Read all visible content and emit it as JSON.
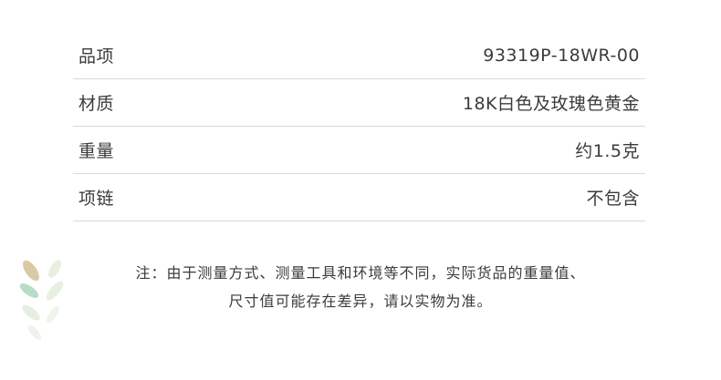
{
  "specs": [
    {
      "label": "品项",
      "value": "93319P-18WR-00"
    },
    {
      "label": "材质",
      "value": "18K白色及玫瑰色黄金"
    },
    {
      "label": "重量",
      "value": "约1.5克"
    },
    {
      "label": "项链",
      "value": "不包含"
    }
  ],
  "note": {
    "line1": "注：由于测量方式、测量工具和环境等不同，实际货品的重量值、",
    "line2": "尺寸值可能存在差异，请以实物为准。"
  },
  "colors": {
    "divider": "#d9d9d9",
    "leaf_gold": "#d9c9a6",
    "leaf_green": "#b8dcc7",
    "leaf_pale": "#e6efe0"
  },
  "icons": [
    "leaf-icon"
  ]
}
